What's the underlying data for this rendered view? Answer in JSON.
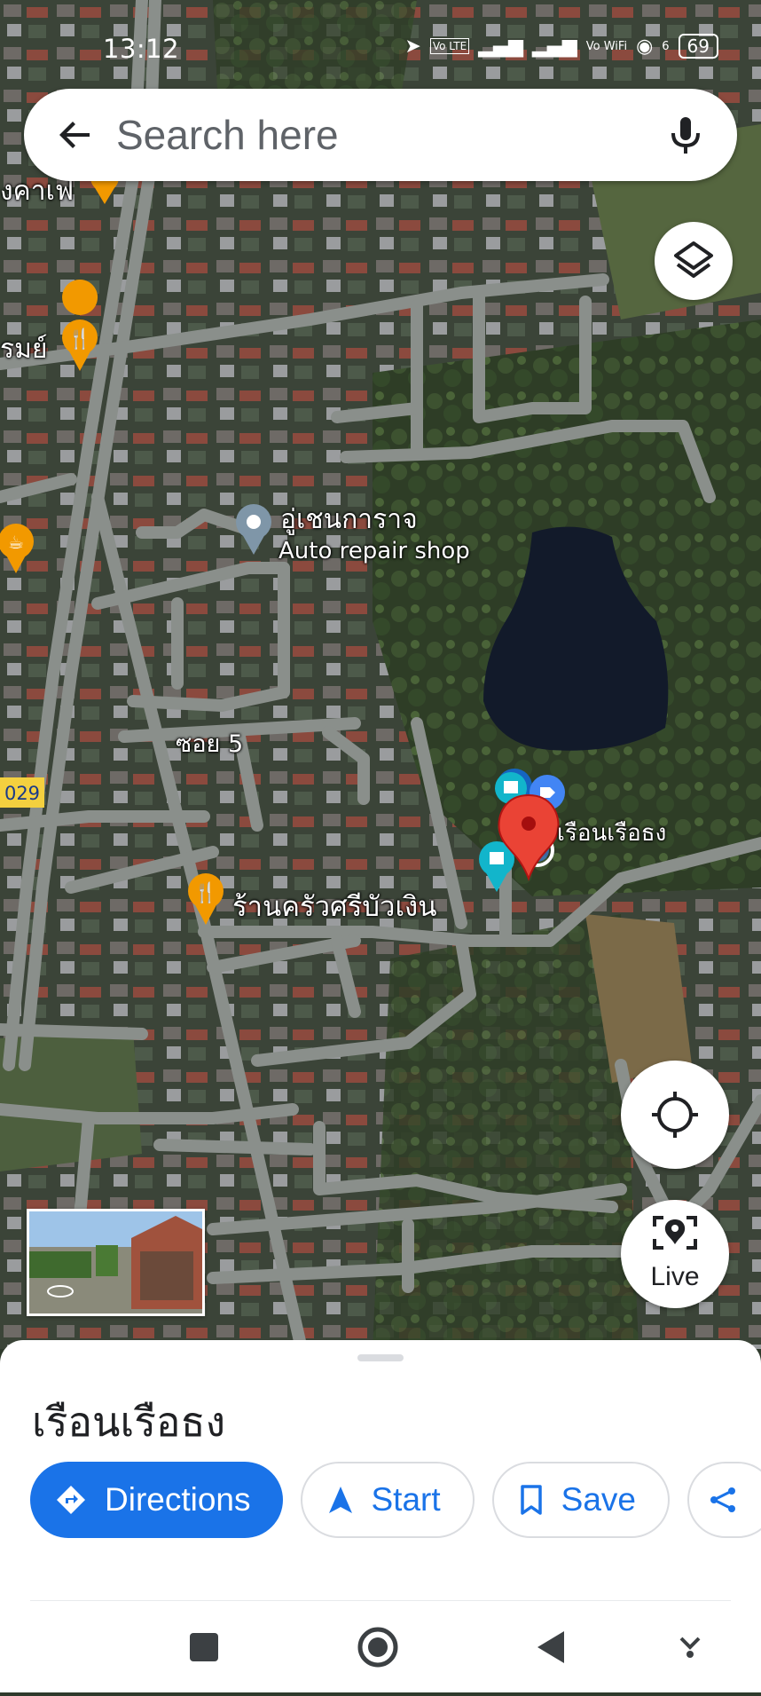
{
  "status_bar": {
    "time": "13:12",
    "battery": "69",
    "network_labels": [
      "Vo LTE",
      "Vo WiFi",
      "6"
    ]
  },
  "search": {
    "placeholder": "Search here"
  },
  "map": {
    "labels": {
      "poi_auto_repair_name": "อู่เชนการาจ",
      "poi_auto_repair_category": "Auto repair shop",
      "soi_label": "ซอย 5",
      "restaurant_name": "ร้านครัวศรีบัวเงิน",
      "selected_place": "เรือนเรือธง",
      "route_shield": "029",
      "partial_label_top": "งคาเฟ",
      "partial_label_left": "รมย์"
    },
    "live_label": "Live"
  },
  "place_sheet": {
    "title": "เรือนเรือธง",
    "actions": {
      "directions": "Directions",
      "start": "Start",
      "save": "Save"
    }
  },
  "colors": {
    "accent": "#1a73e8",
    "pin_red": "#ea4335",
    "poi_orange": "#f29900",
    "poi_teal": "#12b5cb",
    "road": "#8a8f8b"
  },
  "icons": [
    "back-arrow-icon",
    "microphone-icon",
    "layers-icon",
    "my-location-icon",
    "live-view-icon",
    "directions-icon",
    "navigation-arrow-icon",
    "bookmark-icon",
    "share-icon",
    "square-nav-icon",
    "home-circle-nav-icon",
    "back-triangle-nav-icon",
    "down-chevron-nav-icon"
  ]
}
